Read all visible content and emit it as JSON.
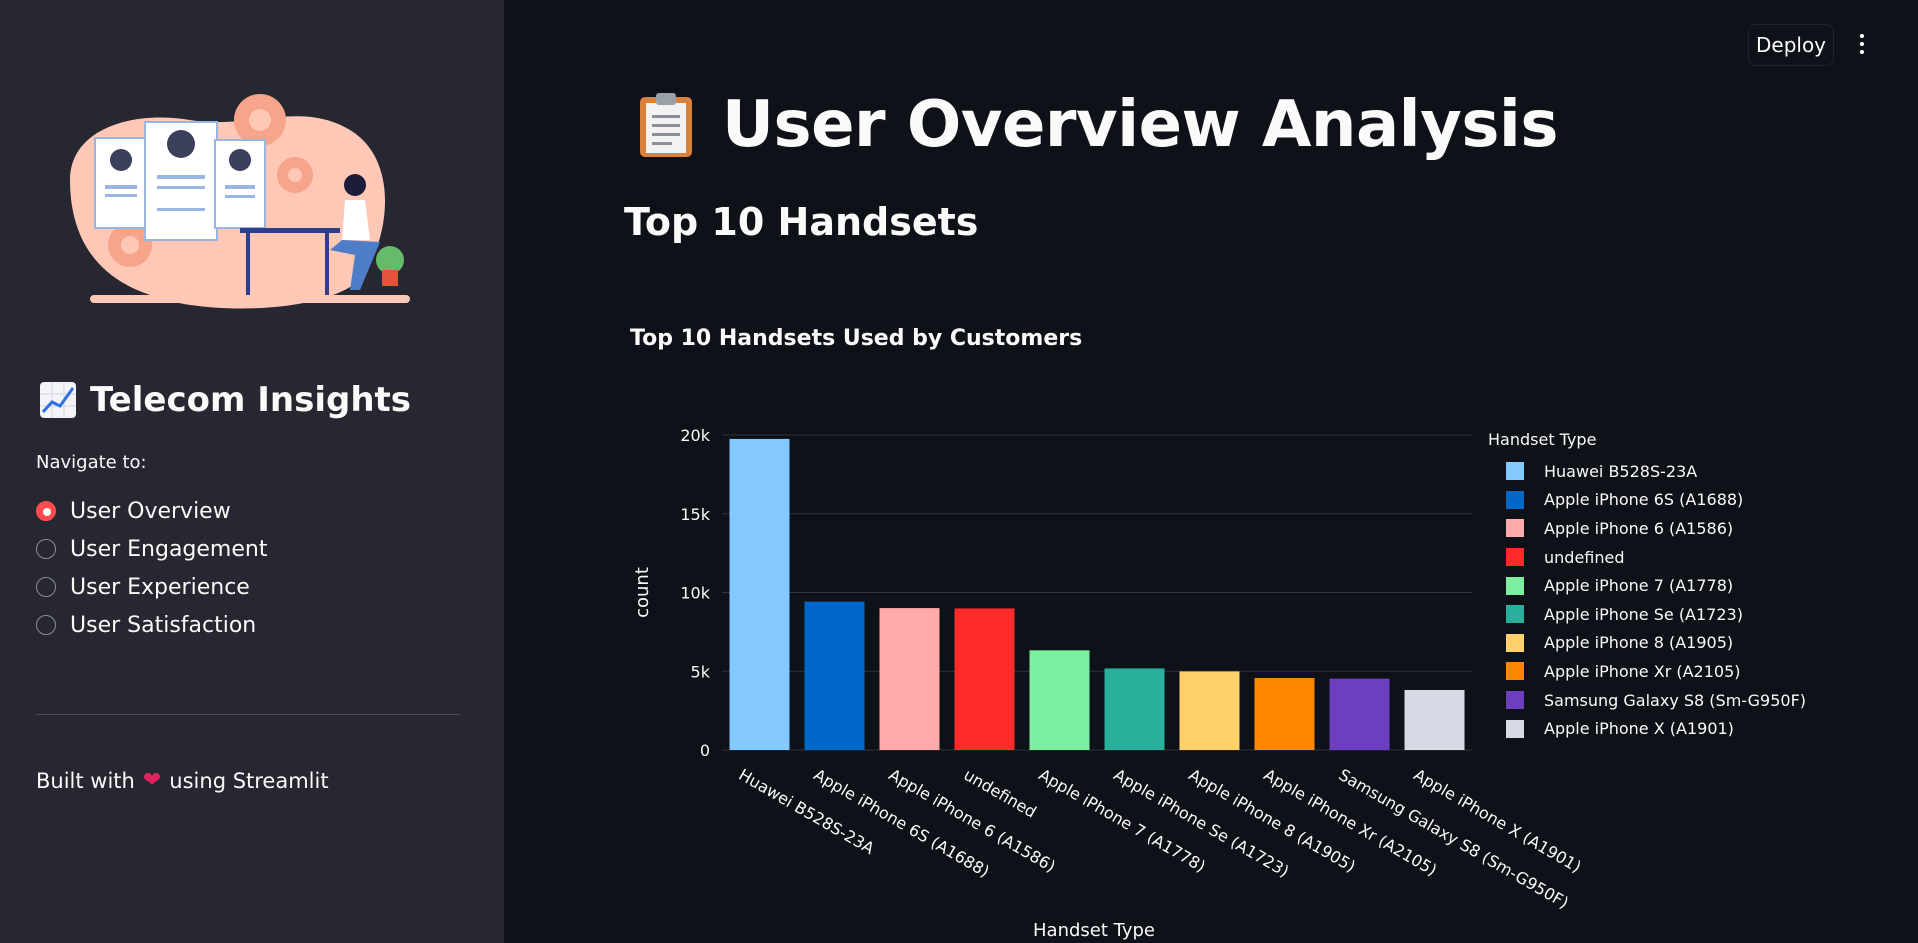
{
  "sidebar": {
    "brand_title": "Telecom Insights",
    "nav_label": "Navigate to:",
    "nav_items": [
      {
        "label": "User Overview",
        "selected": true
      },
      {
        "label": "User Engagement",
        "selected": false
      },
      {
        "label": "User Experience",
        "selected": false
      },
      {
        "label": "User Satisfaction",
        "selected": false
      }
    ],
    "footer_before": "Built with",
    "footer_after": "using Streamlit"
  },
  "toolbar": {
    "deploy_label": "Deploy"
  },
  "main": {
    "title": "User Overview Analysis",
    "subheader": "Top 10 Handsets"
  },
  "colors": {
    "accent": "#ff4b4b",
    "background": "#0e1117",
    "sidebar": "#262730"
  },
  "chart_data": {
    "type": "bar",
    "title": "Top 10 Handsets Used by Customers",
    "xlabel": "Handset Type",
    "ylabel": "count",
    "legend_title": "Handset Type",
    "legend_position": "right",
    "grid": true,
    "ylim": [
      0,
      20000
    ],
    "yticks": [
      0,
      5000,
      10000,
      15000,
      20000
    ],
    "ytick_labels": [
      "0",
      "5k",
      "10k",
      "15k",
      "20k"
    ],
    "categories": [
      "Huawei B528S-23A",
      "Apple iPhone 6S (A1688)",
      "Apple iPhone 6 (A1586)",
      "undefined",
      "Apple iPhone 7 (A1778)",
      "Apple iPhone Se (A1723)",
      "Apple iPhone 8 (A1905)",
      "Apple iPhone Xr (A2105)",
      "Samsung Galaxy S8 (Sm-G950F)",
      "Apple iPhone X (A1901)"
    ],
    "values": [
      19750,
      9420,
      9010,
      8990,
      6330,
      5180,
      4990,
      4570,
      4530,
      3810
    ],
    "colors": [
      "#83c9ff",
      "#0068c9",
      "#ffabab",
      "#ff2b2b",
      "#7defa1",
      "#29b09d",
      "#ffd16a",
      "#ff8700",
      "#6d3fc0",
      "#d5dae5"
    ]
  }
}
